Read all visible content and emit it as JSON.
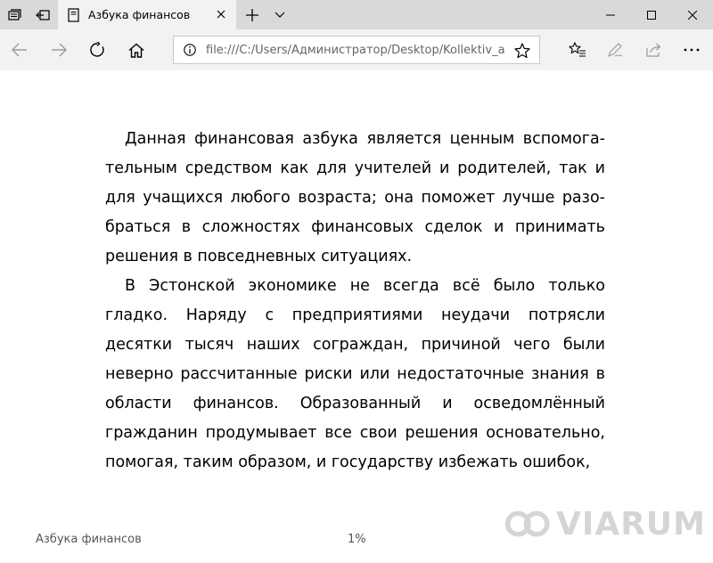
{
  "tab": {
    "title": "Азбука финансов"
  },
  "address_bar": {
    "url": "file:///C:/Users/Администратор/Desktop/Kollektiv_avtorov"
  },
  "reader": {
    "paragraphs": [
      "Данная финансовая азбука является ценным вспомога­тельным средством как для учителей и родителей, так и для учащихся любого возраста; она поможет лучше разо­браться в сложностях финансовых сделок и принимать решения в повседневных ситуациях.",
      "В Эстонской экономике не всегда всё было только гладко. Наряду с предприятиями неудачи потрясли десятки тысяч наших сограждан, причиной чего были неверно рассчитанные риски или недостаточные знания в области финансов. Образованный и осведомлённый гражданин продумывает все свои решения основательно, помогая, таким образом, и государству избежать ошибок,"
    ]
  },
  "footer": {
    "book_title": "Азбука финансов",
    "progress": "1%"
  },
  "watermark": {
    "text": "VIARUM"
  },
  "icons": {
    "set_aside_tabs": "tabs-aside-icon",
    "restore_tabs": "restore-tabs-icon",
    "page": "page-icon",
    "close": "close-icon",
    "new_tab": "plus-icon",
    "tab_menu": "chevron-down-icon",
    "minimize": "minimize-icon",
    "maximize": "maximize-icon",
    "window_close": "window-close-icon",
    "back": "back-arrow-icon",
    "forward": "forward-arrow-icon",
    "refresh": "refresh-icon",
    "home": "home-icon",
    "info": "info-icon",
    "favorite": "star-icon",
    "favorites_hub": "favorites-hub-icon",
    "notes": "pen-icon",
    "share": "share-icon",
    "more": "more-icon"
  }
}
